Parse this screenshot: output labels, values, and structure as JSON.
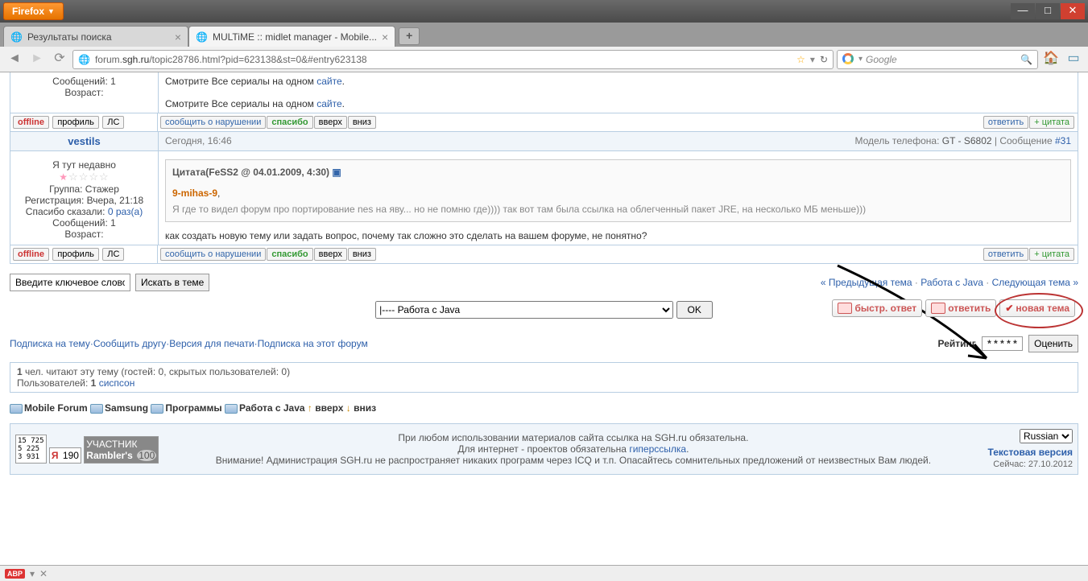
{
  "browser": {
    "name": "Firefox",
    "tabs": [
      {
        "title": "Результаты поиска",
        "active": false
      },
      {
        "title": "MULTiME :: midlet manager - Mobile...",
        "active": true
      }
    ],
    "url_display_prefix": "forum.",
    "url_display_domain": "sgh.ru",
    "url_display_path": "/topic28786.html?pid=623138&st=0&#entry623138",
    "search_placeholder": "Google"
  },
  "post1": {
    "left": {
      "messages": "Сообщений: 1",
      "age": "Возраст:"
    },
    "body_text1": "Смотрите Все сериалы на одном ",
    "body_link1": "сайте",
    "body_text2": "Смотрите Все сериалы на одном ",
    "body_link2": "сайте"
  },
  "post2": {
    "username": "vestils",
    "left": {
      "rank": "Я тут недавно",
      "group": "Группа: Стажер",
      "reg": "Регистрация: Вчера, 21:18",
      "thanks_label": "Спасибо сказали: ",
      "thanks_link": "0 раз(а)",
      "messages": "Сообщений: 1",
      "age": "Возраст:"
    },
    "hdr_time": "Сегодня, 16:46",
    "hdr_phone_label": "Модель телефона: ",
    "hdr_phone": "GT - S6802",
    "hdr_msg_label": " | Сообщение ",
    "hdr_msg_num": "#31",
    "quote_header": "Цитата(FeSS2 @ 04.01.2009, 4:30)",
    "quote_name": "9-mihas-9",
    "quote_text": "Я где то видел форум про портирование nes на яву... но не помню где)))) так вот там была ссылка на облегченный пакет JRE, на несколько МБ меньше)))",
    "body": "как создать новую тему или задать вопрос, почему так сложно это сделать на вашем форуме, не понятно?"
  },
  "buttons": {
    "offline": "offline",
    "profile": "профиль",
    "pm": "ЛС",
    "report": "сообщить о нарушении",
    "thanks": "спасибо",
    "up": "вверх",
    "down": "вниз",
    "reply": "ответить",
    "quote": "+ цитата"
  },
  "search": {
    "placeholder": "Введите ключевое слово",
    "button": "Искать в теме"
  },
  "nav": {
    "prev": "« Предыдущая тема",
    "section": "Работа с Java",
    "next": "Следующая тема »"
  },
  "forum_select": {
    "selected": "|---- Работа с Java",
    "ok": "OK"
  },
  "action_buttons": {
    "quick": "быстр. ответ",
    "reply": "ответить",
    "newtopic": "новая тема"
  },
  "bottom_links": {
    "l1": "Подписка на тему",
    "l2": "Сообщить другу",
    "l3": "Версия для печати",
    "l4": "Подписка на этот форум",
    "rating_label": "Рейтинг",
    "rating_stars": "* * * * *",
    "rate_btn": "Оценить"
  },
  "readers": {
    "line1a": "1",
    "line1b": " чел. читают эту тему (гостей: 0, скрытых пользователей: 0)",
    "line2a": "Пользователей: ",
    "line2b": "1",
    "line2c": "сиспсон"
  },
  "crumbs": {
    "c1": "Mobile Forum",
    "c2": "Samsung",
    "c3": "Программы",
    "c4": "Работа с Java",
    "up": "вверх",
    "down": "вниз"
  },
  "footer": {
    "counter1": "15 725\n5 225\n3 931",
    "counter2": "190",
    "counter3_1": "УЧАСТНИК",
    "counter3_2": "Rambler's",
    "line1": "При любом использовании материалов сайта ссылка на SGH.ru обязательна.",
    "line2a": "Для интернет - проектов обязательна ",
    "line2b": "гиперссылка",
    "line3": "Внимание! Администрация SGH.ru не распространяет никаких программ через ICQ и т.п. Опасайтесь сомнительных предложений от неизвестных Вам людей.",
    "text_ver": "Текстовая версия",
    "lang": "Russian",
    "now": "Сейчас: 27.10.2012"
  }
}
